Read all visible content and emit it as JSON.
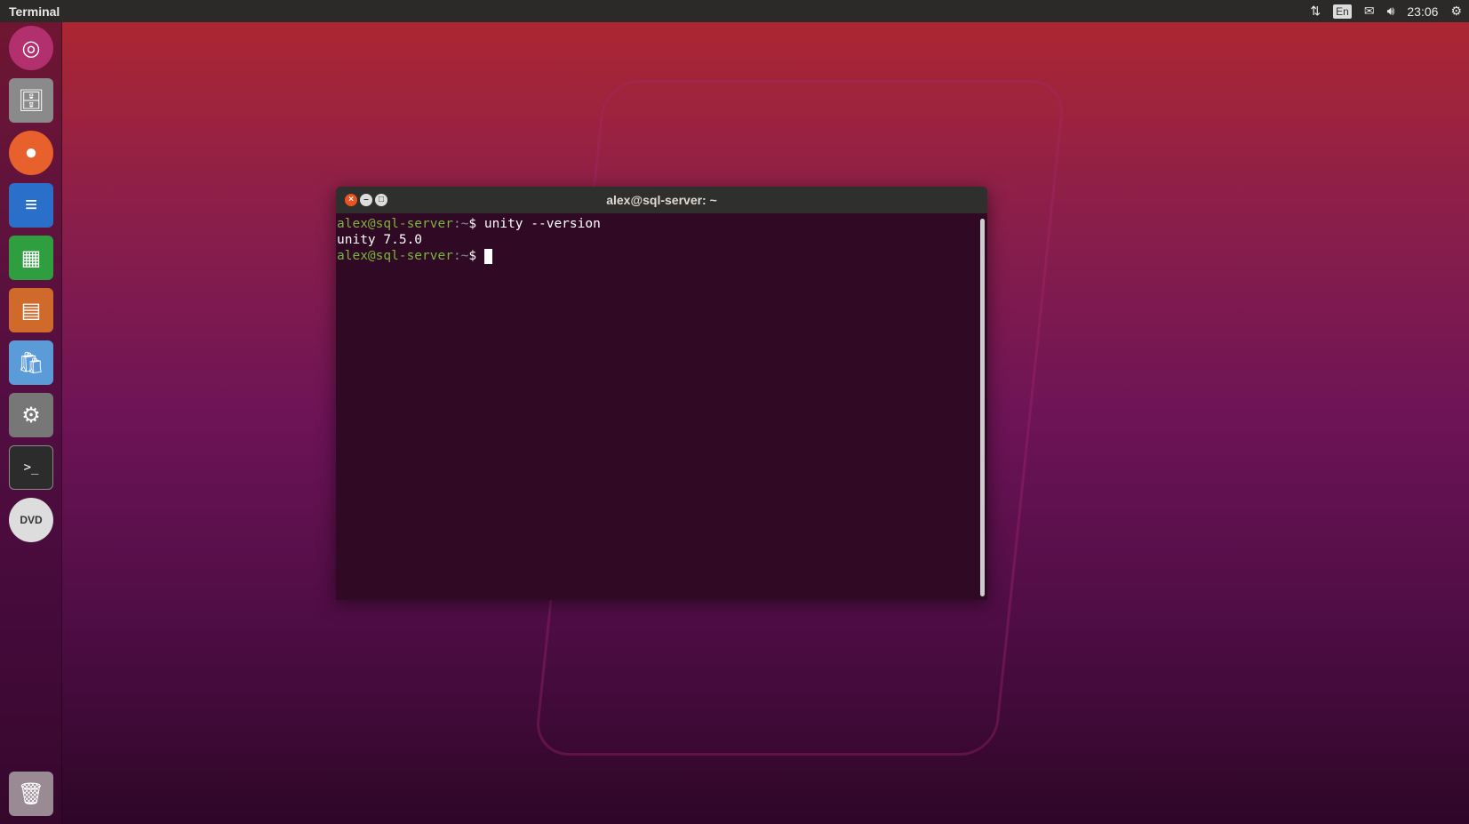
{
  "topbar": {
    "app_title": "Terminal",
    "lang": "En",
    "clock": "23:06"
  },
  "launcher": {
    "items": [
      "ubuntu-dash",
      "files",
      "firefox",
      "libreoffice-writer",
      "libreoffice-calc",
      "libreoffice-impress",
      "software-center",
      "system-settings",
      "terminal",
      "dvd"
    ],
    "trash": "trash"
  },
  "terminal": {
    "title": "alex@sql-server: ~",
    "lines": [
      {
        "user": "alex@sql-server",
        "path": ":~",
        "sym": "$",
        "cmd": " unity --version"
      },
      {
        "output": "unity 7.5.0"
      },
      {
        "user": "alex@sql-server",
        "path": ":~",
        "sym": "$",
        "cmd": " "
      }
    ]
  }
}
